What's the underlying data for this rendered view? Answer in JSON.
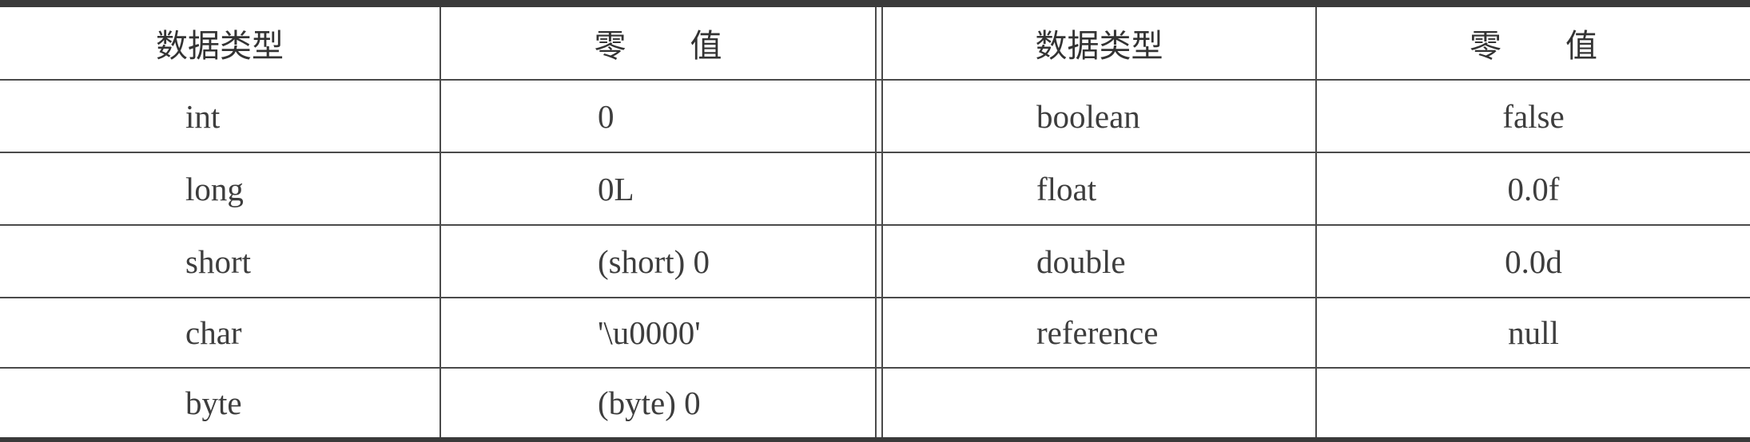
{
  "table": {
    "headers": [
      "数据类型",
      "零　　值",
      "数据类型",
      "零　　值"
    ],
    "rows": [
      [
        "int",
        "0",
        "boolean",
        "false"
      ],
      [
        "long",
        "0L",
        "float",
        "0.0f"
      ],
      [
        "short",
        "(short) 0",
        "double",
        "0.0d"
      ],
      [
        "char",
        "'\\u0000'",
        "reference",
        "null"
      ],
      [
        "byte",
        "(byte) 0",
        "",
        ""
      ]
    ]
  }
}
